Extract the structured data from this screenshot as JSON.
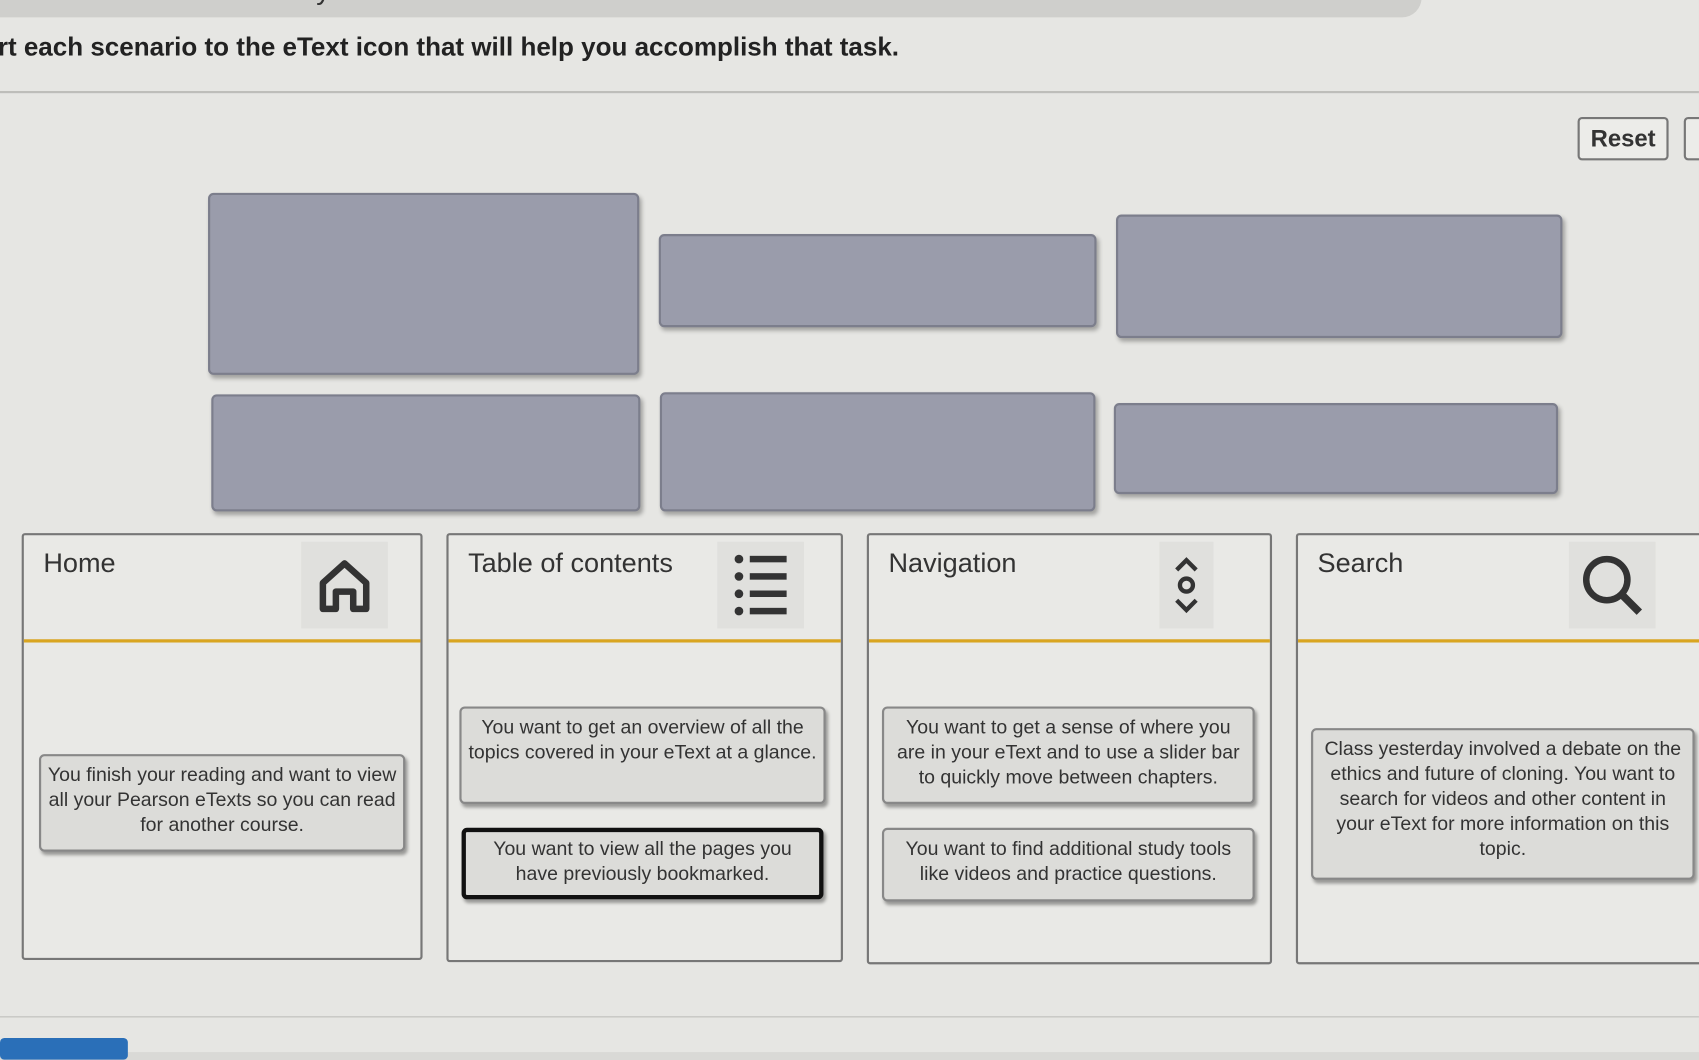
{
  "browser": {
    "url_fragment": "?courseId=12089398&key=3130627887483833911..."
  },
  "instruction": "rt each scenario to the eText icon that will help you accomplish that task.",
  "toolbar": {
    "reset_label": "Reset"
  },
  "bins": [
    {
      "title": "Home",
      "icon": "home-icon"
    },
    {
      "title": "Table of contents",
      "icon": "list-icon"
    },
    {
      "title": "Navigation",
      "icon": "navigation-slider-icon"
    },
    {
      "title": "Search",
      "icon": "search-icon"
    }
  ],
  "cards": [
    "You finish your reading and want to view all your Pearson eTexts so you can read for another course.",
    "You want to get an overview of all the topics covered in your eText at a glance.",
    "You want to view all the pages you have previously bookmarked.",
    "You want to get a sense of where you are in your eText and to use a slider bar to quickly move between chapters.",
    "You want to find additional study tools like videos and practice questions.",
    "Class yesterday involved a debate on the ethics and future of cloning. You want to search for videos and other content in your eText for more information on this topic."
  ],
  "colors": {
    "slot": "#9a9cab",
    "accent": "#d9a520"
  }
}
